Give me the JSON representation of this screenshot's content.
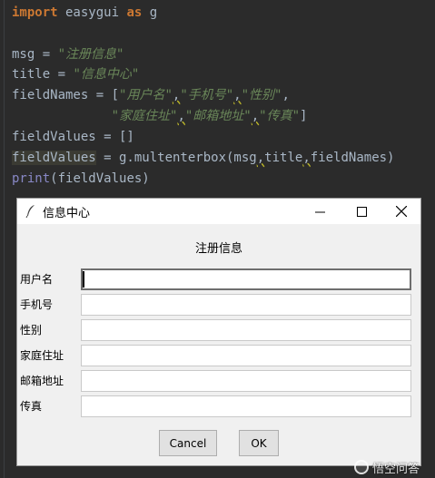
{
  "code": {
    "l1": {
      "kw1": "import",
      "mod": " easygui ",
      "kw2": "as",
      "alias": " g"
    },
    "l3": {
      "var": "msg = ",
      "str": "\"注册信息\""
    },
    "l4": {
      "var": "title = ",
      "str": "\"信息中心\""
    },
    "l5": {
      "var": "fieldNames = [",
      "s1": "\"用户名\"",
      "c1": ",",
      "s2": "\"手机号\"",
      "c2": ",",
      "s3": "\"性别\"",
      "end": ","
    },
    "l6": {
      "indent": "             ",
      "s4": "\"家庭住址\"",
      "c1": ",",
      "s5": "\"邮箱地址\"",
      "c2": ",",
      "s6": "\"传真\"",
      "end": "]"
    },
    "l7": {
      "text": "fieldValues = []"
    },
    "l8": {
      "var": "fieldValues",
      "eq": " = g.multenterbox(msg",
      "c1": ",",
      "a2": "title",
      "c2": ",",
      "a3": "fieldNames)"
    },
    "l9": {
      "fn": "print",
      "rest": "(fieldValues)"
    }
  },
  "dialog": {
    "title": "信息中心",
    "message": "注册信息",
    "fields": [
      {
        "label": "用户名",
        "value": ""
      },
      {
        "label": "手机号",
        "value": ""
      },
      {
        "label": "性别",
        "value": ""
      },
      {
        "label": "家庭住址",
        "value": ""
      },
      {
        "label": "邮箱地址",
        "value": ""
      },
      {
        "label": "传真",
        "value": ""
      }
    ],
    "cancel_label": "Cancel",
    "ok_label": "OK"
  },
  "watermark": {
    "text": "悟空问答"
  },
  "colors": {
    "editor_bg": "#2b2b2b",
    "keyword": "#cc7832",
    "string": "#6a8759",
    "builtin": "#8888c6",
    "dialog_bg": "#f0f0f0"
  }
}
